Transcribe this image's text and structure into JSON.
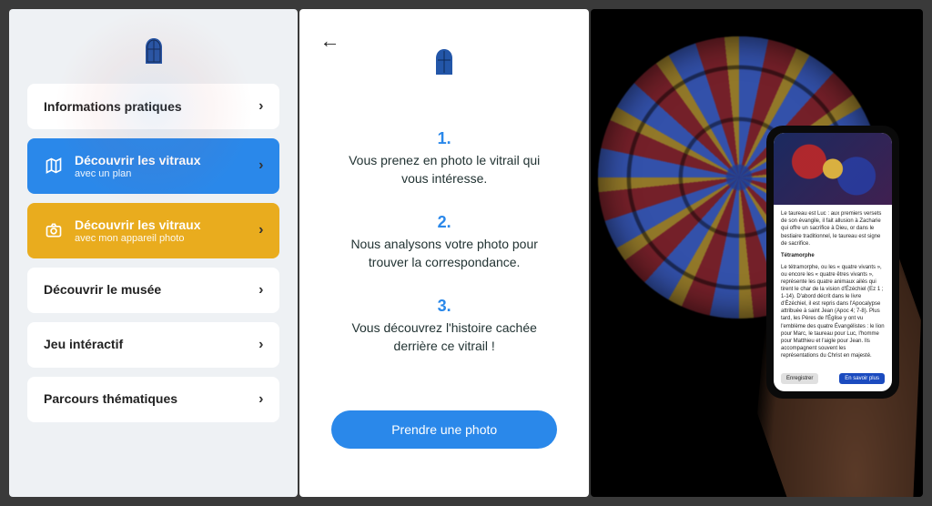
{
  "menu": {
    "items": [
      {
        "label": "Informations pratiques",
        "sub": ""
      },
      {
        "label": "Découvrir les vitraux",
        "sub": "avec un plan"
      },
      {
        "label": "Découvrir les vitraux",
        "sub": "avec mon appareil photo"
      },
      {
        "label": "Découvrir le musée",
        "sub": ""
      },
      {
        "label": "Jeu intéractif",
        "sub": ""
      },
      {
        "label": "Parcours thématiques",
        "sub": ""
      }
    ]
  },
  "steps": {
    "s1_num": "1.",
    "s1": "Vous prenez en photo le vitrail qui vous intéresse.",
    "s2_num": "2.",
    "s2": "Nous analysons votre photo pour trouver la correspondance.",
    "s3_num": "3.",
    "s3": "Vous découvrez l'histoire cachée derrière ce vitrail !",
    "cta": "Prendre une photo"
  },
  "phone": {
    "p1": "Le taureau est Luc : aux premiers versets de son évangile, il fait allusion à Zacharie qui offre un sacrifice à Dieu, or dans le bestiaire traditionnel, le taureau est signe de sacrifice.",
    "heading": "Tétramorphe",
    "p2": "Le tétramorphe, ou les « quatre vivants », ou encore les « quatre êtres vivants », représente les quatre animaux ailés qui tirent le char de la vision d'Ézéchiel (Ez 1 ; 1-14). D'abord décrit dans le livre d'Ézéchiel, il est repris dans l'Apocalypse attribuée à saint Jean (Apoc 4; 7-8). Plus tard, les Pères de l'Église y ont vu l'emblème des quatre Évangélistes : le lion pour Marc, le taureau pour Luc, l'homme pour Matthieu et l'aigle pour Jean. Ils accompagnent souvent les représentations du Christ en majesté.",
    "save": "Enregistrer",
    "more": "En savoir plus"
  }
}
